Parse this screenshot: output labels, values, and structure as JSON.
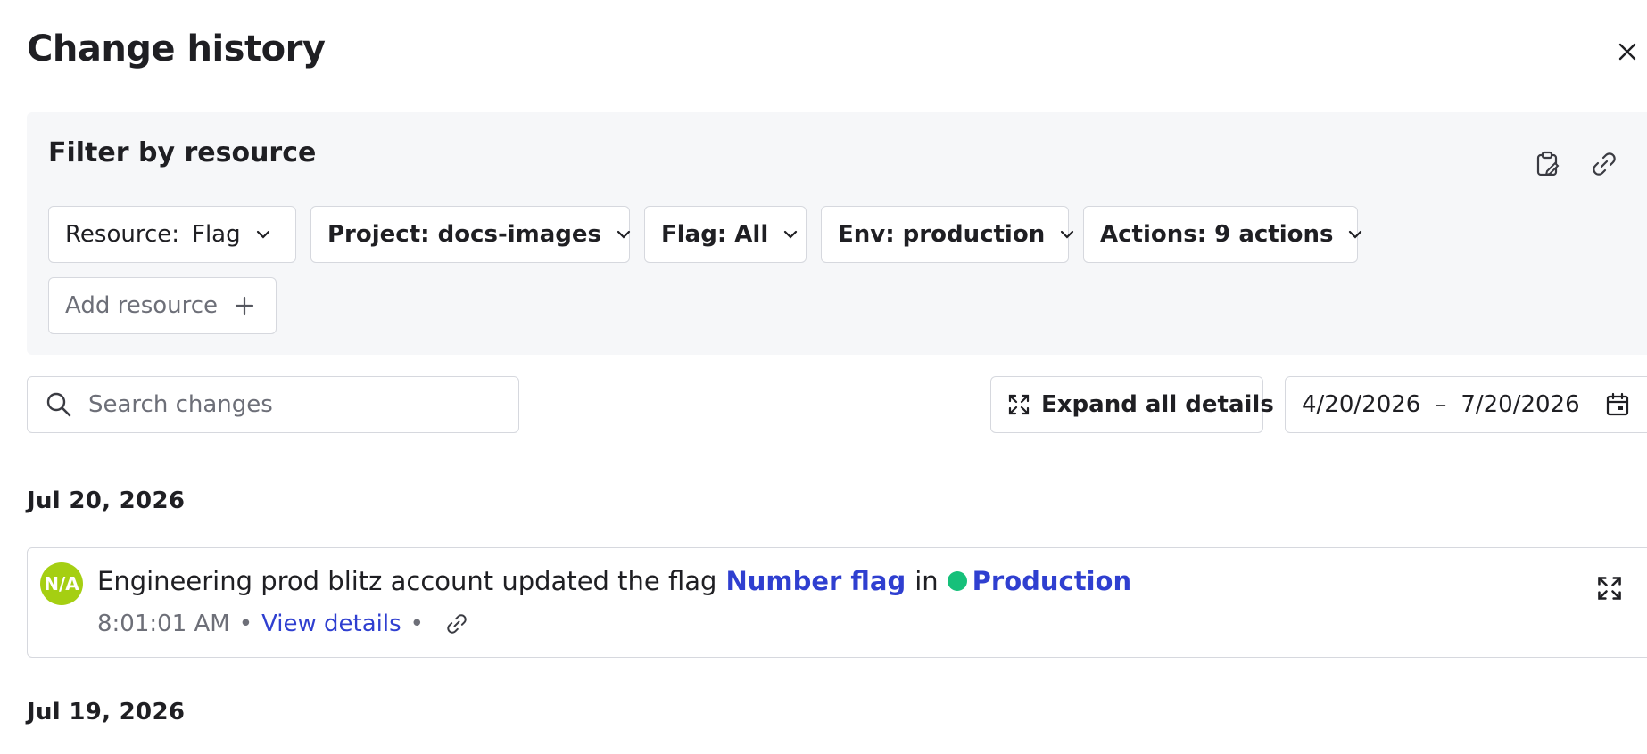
{
  "drawer": {
    "title": "Change history",
    "close_icon": "close-icon"
  },
  "filter": {
    "title": "Filter by resource",
    "chips": [
      {
        "label": "Resource:",
        "value": "Flag"
      },
      {
        "label": "Project: docs-images"
      },
      {
        "label": "Flag: All"
      },
      {
        "label": "Env: production"
      },
      {
        "label": "Actions: 9 actions"
      }
    ],
    "add_resource_label": "Add resource",
    "icons": [
      "clipboard-icon",
      "link-icon"
    ]
  },
  "toolbar": {
    "search_placeholder": "Search changes",
    "expand_all_label": "Expand all details",
    "date_start": "4/20/2026",
    "date_separator": "–",
    "date_end": "7/20/2026"
  },
  "groups": [
    {
      "date": "Jul 20, 2026",
      "entries": [
        {
          "avatar_initials": "N/A",
          "actor_text": "Engineering prod blitz account updated the flag",
          "flag_name": "Number flag",
          "in_text": "in",
          "environment": "Production",
          "environment_color": "#16c07a",
          "time": "8:01:01 AM",
          "view_details_label": "View details"
        }
      ]
    },
    {
      "date": "Jul 19, 2026",
      "entries": []
    }
  ],
  "colors": {
    "accent_link": "#2f3fd0",
    "avatar_bg": "#a5cf12",
    "panel_bg": "#f6f7f9"
  }
}
